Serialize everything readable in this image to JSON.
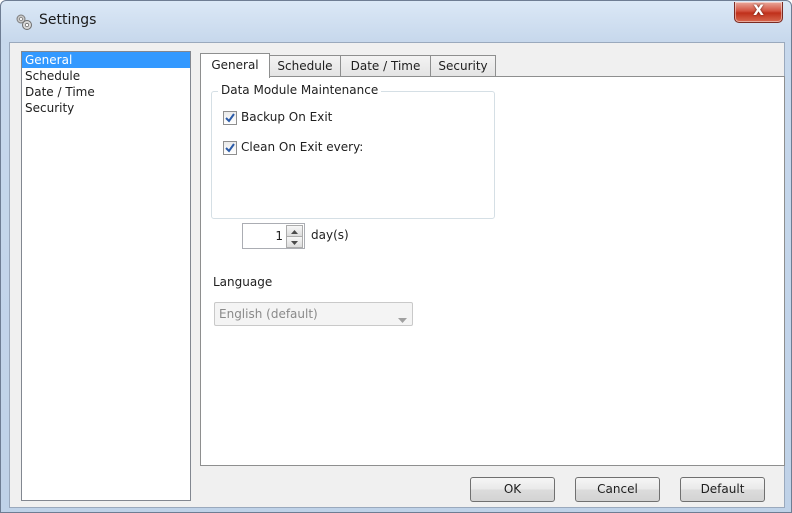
{
  "window": {
    "title": "Settings",
    "close_label": "X"
  },
  "nav": {
    "items": [
      {
        "label": "General",
        "selected": true
      },
      {
        "label": "Schedule",
        "selected": false
      },
      {
        "label": "Date / Time",
        "selected": false
      },
      {
        "label": "Security",
        "selected": false
      }
    ]
  },
  "tabs": [
    {
      "label": "General",
      "active": true
    },
    {
      "label": "Schedule",
      "active": false
    },
    {
      "label": "Date / Time",
      "active": false
    },
    {
      "label": "Security",
      "active": false
    }
  ],
  "general": {
    "group_title": "Data Module Maintenance",
    "backup_on_exit": {
      "label": "Backup On Exit",
      "checked": true
    },
    "clean_on_exit": {
      "label": "Clean On Exit every:",
      "checked": true
    },
    "interval": {
      "value": "1",
      "unit": "day(s)"
    },
    "language": {
      "label": "Language",
      "selected": "English (default)",
      "enabled": false
    }
  },
  "buttons": {
    "ok": "OK",
    "cancel": "Cancel",
    "default": "Default"
  },
  "colors": {
    "selection": "#3399ff",
    "panel": "#ffffff",
    "client": "#f0f0f0",
    "check": "#2a5aa8"
  },
  "icons": {
    "app": "gears-icon",
    "close": "close-icon",
    "check": "check-icon",
    "spin_up": "chevron-up-icon",
    "spin_down": "chevron-down-icon",
    "dropdown": "chevron-down-icon"
  }
}
